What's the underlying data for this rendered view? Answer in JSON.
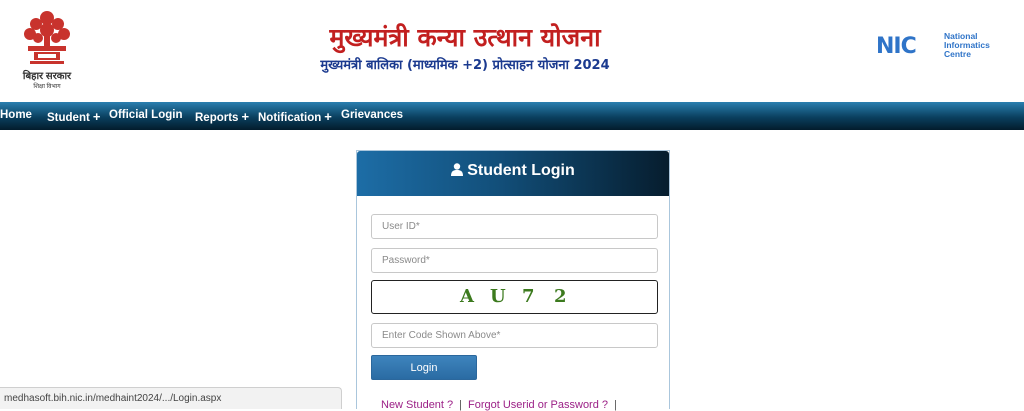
{
  "header": {
    "emblem_caption": "बिहार सरकार",
    "emblem_subcaption": "शिक्षा विभाग",
    "title": "मुख्यमंत्री कन्या उत्थान योजना",
    "subtitle": "मुख्यमंत्री बालिका (माध्यमिक +2) प्रोत्साहन योजना 2024",
    "nic_mark": "NIC",
    "nic_line1": "National",
    "nic_line2": "Informatics",
    "nic_line3": "Centre"
  },
  "nav": {
    "items": [
      {
        "label": "Home"
      },
      {
        "label": "Student",
        "plus": "+"
      },
      {
        "label": "Official Login"
      },
      {
        "label": "Reports",
        "plus": "+"
      },
      {
        "label": "Notification",
        "plus": "+"
      },
      {
        "label": "Grievances"
      }
    ]
  },
  "login": {
    "title": "Student Login",
    "user_id_placeholder": "User ID*",
    "password_placeholder": "Password*",
    "captcha_chars": [
      "A",
      "U",
      "7",
      "2"
    ],
    "code_placeholder": "Enter Code Shown Above*",
    "login_button": "Login",
    "new_student_link": "New Student ?",
    "forgot_link": "Forgot Userid or Password ?",
    "separator": "|"
  },
  "status": {
    "url": "medhasoft.bih.nic.in/medhaint2024/.../Login.aspx"
  },
  "colors": {
    "title_red": "#c21f1f",
    "subtitle_blue": "#1b3a8f",
    "nav_blue": "#0a3f5e",
    "captcha_green": "#3c7a1e",
    "link_purple": "#9b1f86"
  }
}
